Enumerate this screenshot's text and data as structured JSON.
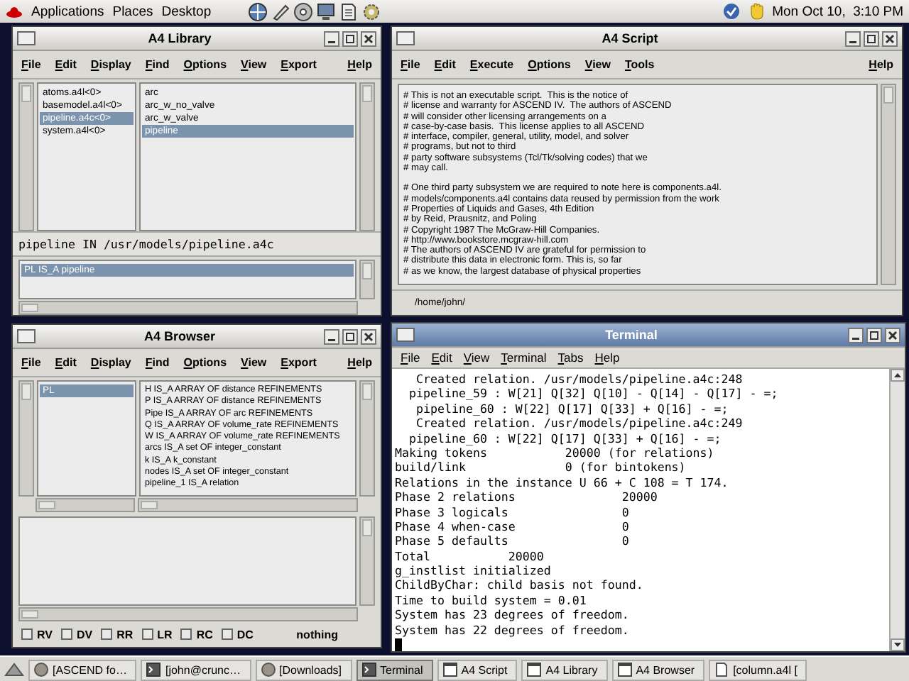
{
  "top_panel": {
    "menus": [
      "Applications",
      "Places",
      "Desktop"
    ],
    "clock": "Mon Oct 10,  3:10 PM"
  },
  "library": {
    "title": "A4 Library",
    "active": false,
    "menus": [
      "File",
      "Edit",
      "Display",
      "Find",
      "Options",
      "View",
      "Export",
      "Help"
    ],
    "types": [
      {
        "label": "atoms.a4l<0>",
        "selected": false
      },
      {
        "label": "basemodel.a4l<0>",
        "selected": false
      },
      {
        "label": "pipeline.a4c<0>",
        "selected": true
      },
      {
        "label": "system.a4l<0>",
        "selected": false
      }
    ],
    "definitions": [
      {
        "label": "arc",
        "selected": false
      },
      {
        "label": "arc_w_no_valve",
        "selected": false
      },
      {
        "label": "arc_w_valve",
        "selected": false
      },
      {
        "label": "pipeline",
        "selected": true
      }
    ],
    "path": "pipeline IN /usr/models/pipeline.a4c",
    "instances": [
      {
        "label": "PL IS_A pipeline",
        "selected": true
      }
    ]
  },
  "script": {
    "title": "A4 Script",
    "active": false,
    "menus": [
      "File",
      "Edit",
      "Execute",
      "Options",
      "View",
      "Tools",
      "Help"
    ],
    "paragraphs": [
      [
        "# This is not an executable script.  This is the notice of",
        "# license and warranty for ASCEND IV.  The authors of ASCEND",
        "# will consider other licensing arrangements on a",
        "# case-by-case basis.  This license applies to all ASCEND",
        "# interface, compiler, general, utility, model, and solver",
        "# programs, but not to third",
        "# party software subsystems (Tcl/Tk/solving codes) that we",
        "# may call."
      ],
      [
        "# One third party subsystem we are required to note here is components.a4l.",
        "# models/components.a4l contains data reused by permission from the work",
        "# Properties of Liquids and Gases, 4th Edition",
        "# by Reid, Prausnitz, and Poling",
        "# Copyright 1987 The McGraw-Hill Companies.",
        "# http://www.bookstore.mcgraw-hill.com",
        "# The authors of ASCEND IV are grateful for permission to",
        "# distribute this data in electronic form. This is, so far",
        "# as we know, the largest database of physical properties"
      ]
    ],
    "status": "/home/john/"
  },
  "browser": {
    "title": "A4 Browser",
    "active": false,
    "menus": [
      "File",
      "Edit",
      "Display",
      "Find",
      "Options",
      "View",
      "Export",
      "Help"
    ],
    "instances": [
      {
        "label": "PL",
        "selected": true
      }
    ],
    "parts": [
      "H IS_A ARRAY OF distance REFINEMENTS",
      "P IS_A ARRAY OF distance REFINEMENTS",
      "Pipe IS_A ARRAY OF arc REFINEMENTS",
      "Q IS_A ARRAY OF volume_rate REFINEMENTS",
      "W IS_A ARRAY OF volume_rate REFINEMENTS",
      "arcs IS_A set OF integer_constant",
      "k IS_A k_constant",
      "nodes IS_A set OF integer_constant",
      "pipeline_1 IS_A relation"
    ],
    "options": [
      {
        "label": "RV",
        "checked": false
      },
      {
        "label": "DV",
        "checked": false
      },
      {
        "label": "RR",
        "checked": false
      },
      {
        "label": "LR",
        "checked": false
      },
      {
        "label": "RC",
        "checked": false
      },
      {
        "label": "DC",
        "checked": false
      }
    ],
    "status": "nothing"
  },
  "terminal": {
    "title": "Terminal",
    "active": true,
    "menus": [
      "File",
      "Edit",
      "View",
      "Terminal",
      "Tabs",
      "Help"
    ],
    "lines": [
      "   Created relation. /usr/models/pipeline.a4c:248",
      "  pipeline_59 : W[21] Q[32] Q[10] - Q[14] - Q[17] - =;",
      "   pipeline_60 : W[22] Q[17] Q[33] + Q[16] - =;",
      "   Created relation. /usr/models/pipeline.a4c:249",
      "  pipeline_60 : W[22] Q[17] Q[33] + Q[16] - =;",
      "Making tokens           20000 (for relations)",
      "build/link              0 (for bintokens)",
      "Relations in the instance U 66 + C 108 = T 174.",
      "Phase 2 relations               20000",
      "Phase 3 logicals                0",
      "Phase 4 when-case               0",
      "Phase 5 defaults                0",
      "Total           20000",
      "g_instlist initialized",
      "ChildByChar: child basis not found.",
      "Time to build system = 0.01",
      "System has 23 degrees of freedom.",
      "System has 22 degrees of freedom."
    ]
  },
  "taskbar": {
    "items": [
      {
        "label": "[ASCEND fo…",
        "kind": "browser",
        "selected": false
      },
      {
        "label": "[john@crunc…",
        "kind": "terminal",
        "selected": false
      },
      {
        "label": "[Downloads]",
        "kind": "browser",
        "selected": false
      },
      {
        "label": "Terminal",
        "kind": "terminal",
        "selected": true
      },
      {
        "label": "A4 Script",
        "kind": "window",
        "selected": false
      },
      {
        "label": "A4 Library",
        "kind": "window",
        "selected": false
      },
      {
        "label": "A4 Browser",
        "kind": "window",
        "selected": false
      },
      {
        "label": "[column.a4l [",
        "kind": "file",
        "selected": false
      }
    ]
  }
}
